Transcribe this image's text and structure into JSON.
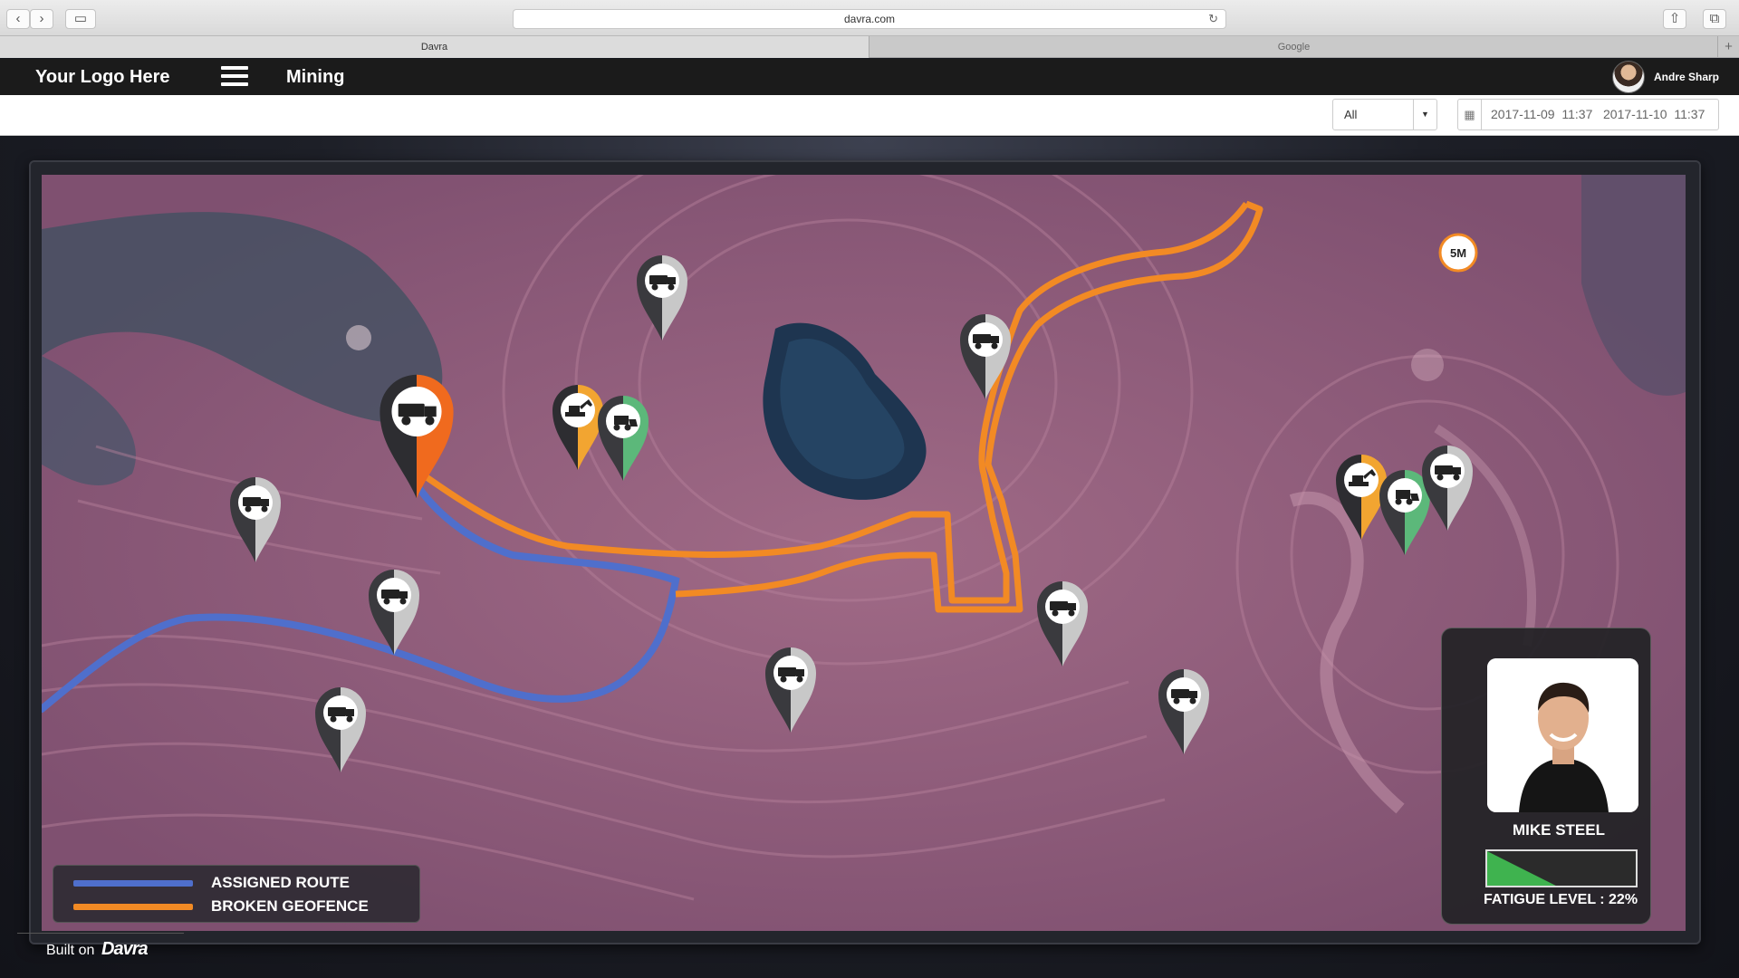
{
  "browser": {
    "url": "davra.com",
    "tabs": [
      {
        "label": "Davra"
      },
      {
        "label": "Google"
      }
    ]
  },
  "header": {
    "logo": "Your Logo Here",
    "page_title": "Mining",
    "user": {
      "name": "Andre Sharp"
    }
  },
  "filters": {
    "asset_filter": "All",
    "date_range": "2017-11-09  11:37   2017-11-10  11:37"
  },
  "map": {
    "legend": [
      {
        "label": "ASSIGNED ROUTE",
        "color": "#4f6fcc"
      },
      {
        "label": "BROKEN GEOFENCE",
        "color": "#f28a24"
      }
    ],
    "marker_colors": {
      "idle": "#3a3a3e",
      "active": "#f06a1e",
      "warning": "#f2a531",
      "ok": "#5cb87a",
      "light": "#c8c8c8"
    },
    "markers": [
      {
        "type": "dump-truck",
        "status": "selected"
      },
      {
        "type": "excavator",
        "status": "warning"
      },
      {
        "type": "loader",
        "status": "ok"
      },
      {
        "type": "dump-truck",
        "status": "idle"
      },
      {
        "type": "dump-truck",
        "status": "idle"
      },
      {
        "type": "dump-truck",
        "status": "idle"
      },
      {
        "type": "dump-truck",
        "status": "idle"
      },
      {
        "type": "dump-truck",
        "status": "idle"
      },
      {
        "type": "dump-truck",
        "status": "idle"
      },
      {
        "type": "dump-truck",
        "status": "idle"
      },
      {
        "type": "dump-truck",
        "status": "idle"
      },
      {
        "type": "excavator",
        "status": "warning"
      },
      {
        "type": "loader",
        "status": "ok"
      },
      {
        "type": "dump-truck",
        "status": "idle"
      }
    ],
    "speed_sign": "5M"
  },
  "driver": {
    "name": "MIKE STEEL",
    "fatigue_label": "FATIGUE LEVEL : 22%",
    "fatigue_level": 0.22,
    "fatigue_color": "#3fb34f"
  },
  "footer": {
    "built_on": "Built on",
    "brand": "Davra"
  }
}
